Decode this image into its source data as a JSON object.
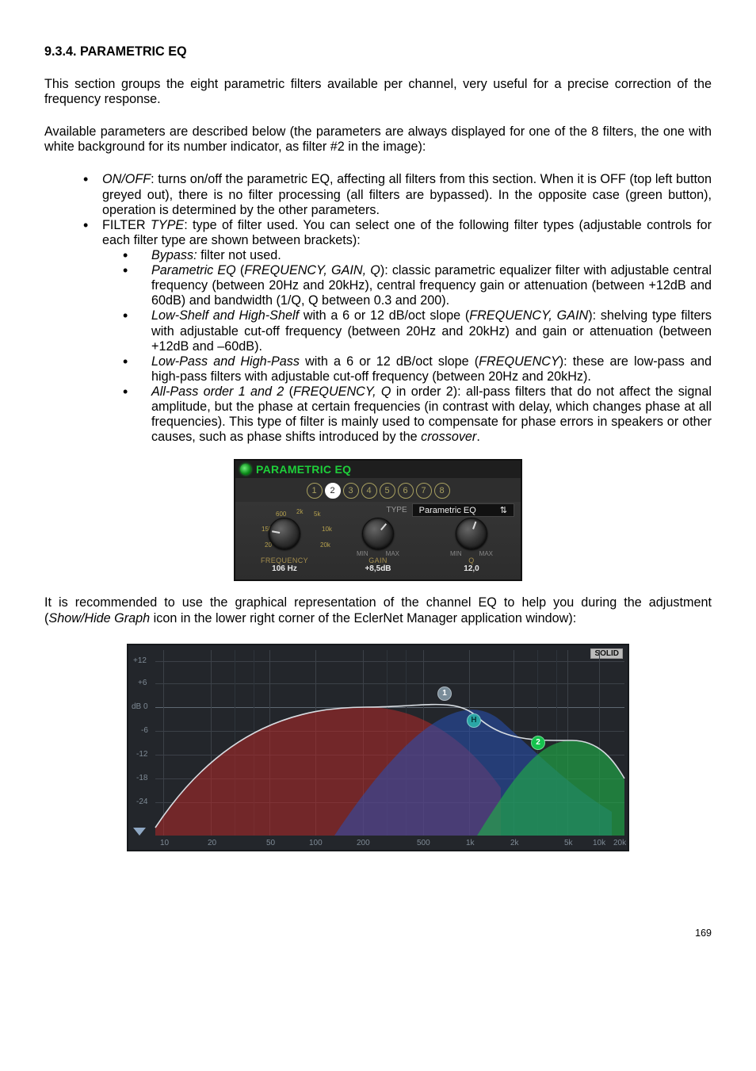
{
  "heading": "9.3.4. PARAMETRIC EQ",
  "para1": "This section groups the eight parametric filters available per channel, very useful for a precise correction of the frequency response.",
  "para2": "Available parameters are described below (the parameters are always displayed for one of the 8 filters, the one with white background for its number indicator, as filter #2 in the image):",
  "bullets": {
    "onoff": {
      "label": "ON/OFF",
      "text": ": turns on/off the parametric EQ, affecting all filters from this section. When it is OFF (top left button greyed out), there is no filter processing (all filters are bypassed). In the opposite case (green button), operation is determined by the other parameters."
    },
    "filter_type": {
      "prefix": "FILTER ",
      "label": "TYPE",
      "text": ": type of filter used. You can select one of the following filter types (adjustable controls for each filter type are shown between brackets):"
    },
    "sub": {
      "bypass": {
        "label": "Bypass:",
        "text": " filter not used."
      },
      "parametric": {
        "label": "Parametric EQ",
        "args": "FREQUENCY, GAIN, Q",
        "text": "): classic parametric equalizer filter with adjustable central frequency (between 20Hz and 20kHz), central frequency gain or attenuation (between +12dB and 60dB) and bandwidth (1/Q, Q between 0.3 and 200)."
      },
      "shelf": {
        "label": "Low-Shelf and High-Shelf",
        "mid": " with a 6 or 12 dB/oct slope (",
        "args": "FREQUENCY, GAIN",
        "text": "): shelving type filters with adjustable cut-off frequency (between 20Hz and 20kHz) and gain or attenuation (between +12dB and –60dB)."
      },
      "pass": {
        "label": "Low-Pass and High-Pass",
        "mid": " with a 6 or 12 dB/oct slope (",
        "args": "FREQUENCY",
        "text": "): these are low-pass and high-pass filters with adjustable cut-off frequency (between 20Hz and 20kHz)."
      },
      "allpass": {
        "label": "All-Pass order 1 and 2",
        "mid": " (",
        "args": "FREQUENCY, Q",
        "post": " in order 2): all-pass filters that do not affect the signal amplitude, but the phase at certain frequencies (in contrast with delay, which changes phase at all frequencies). This type of filter is mainly used to compensate for phase errors in speakers or other causes, such as phase shifts introduced by the ",
        "tail_i": "crossover",
        "dot": "."
      }
    }
  },
  "panel": {
    "title": "PARAMETRIC EQ",
    "filters": [
      "1",
      "2",
      "3",
      "4",
      "5",
      "6",
      "7",
      "8"
    ],
    "active_index": 1,
    "type_label": "TYPE",
    "type_value": "Parametric EQ",
    "freq": {
      "label": "FREQUENCY",
      "value": "106 Hz",
      "scale": {
        "t600": "600",
        "t2k": "2k",
        "t5k": "5k",
        "t150": "150",
        "t10k": "10k",
        "t20": "20",
        "t20k": "20k"
      }
    },
    "gain": {
      "min": "MIN",
      "max": "MAX",
      "label": "GAIN",
      "value": "+8,5dB"
    },
    "q": {
      "min": "MIN",
      "max": "MAX",
      "label": "Q",
      "value": "12,0"
    }
  },
  "para3_a": "It is recommended to use the graphical representation of the channel EQ to help you during the adjustment (",
  "para3_i": "Show/Hide Graph",
  "para3_b": " icon in the lower right corner of the EclerNet Manager application window):",
  "graph": {
    "solid": "SOLID",
    "ylabels": [
      "+12",
      "+6",
      "dB 0",
      "-6",
      "-12",
      "-18",
      "-24"
    ],
    "xlabels": [
      "10",
      "20",
      "50",
      "100",
      "200",
      "500",
      "1k",
      "2k",
      "5k",
      "10k",
      "20k"
    ],
    "badges": {
      "b1": "1",
      "bH": "H",
      "b2": "2"
    }
  },
  "page_number": "169"
}
